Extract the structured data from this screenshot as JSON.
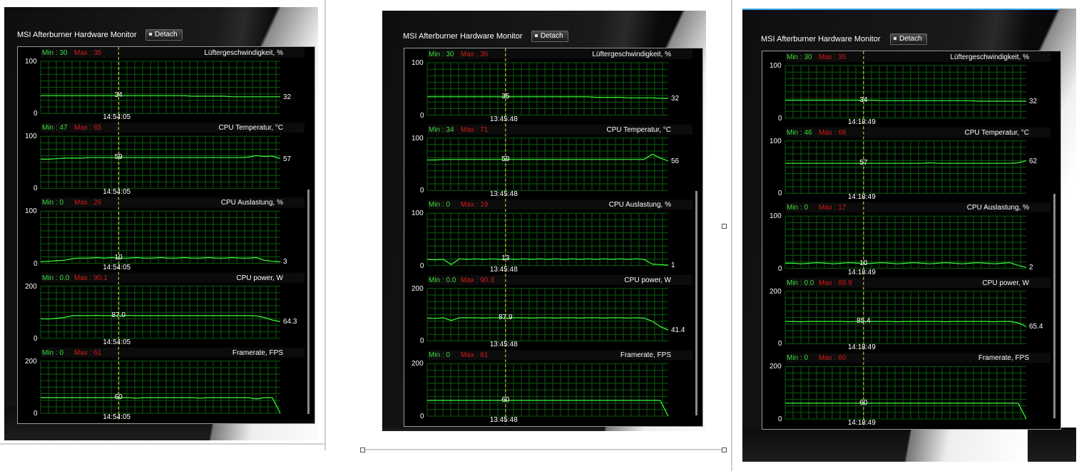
{
  "colors": {
    "grid": "#0b5d0b",
    "line": "#3cff3c",
    "cursor": "#e6e65a",
    "min": "#3cdd3c",
    "max": "#d41a1a"
  },
  "panels": [
    {
      "title": "MSI Afterburner Hardware Monitor",
      "detach": "Detach",
      "graphs": [
        {
          "name": "Lüftergeschwindigkeit, %",
          "min": "Min : 30",
          "max": "Max : 35",
          "ymax": "100",
          "ymin": "0",
          "cursor": "34",
          "current": "32",
          "time": "14:54:05",
          "series": [
            34,
            34,
            34,
            34,
            34,
            34,
            34,
            34,
            34,
            34,
            34,
            34,
            34,
            34,
            34,
            34,
            34,
            34,
            34,
            33,
            33,
            33,
            33,
            33,
            32,
            32,
            32,
            32,
            32,
            32,
            32
          ]
        },
        {
          "name": "CPU Temperatur, °C",
          "min": "Min : 47",
          "max": "Max : 65",
          "ymax": "100",
          "ymin": "0",
          "cursor": "59",
          "current": "57",
          "time": "14:54:05",
          "series": [
            56,
            56,
            57,
            58,
            58,
            58,
            59,
            59,
            59,
            59,
            59,
            59,
            59,
            59,
            59,
            59,
            59,
            59,
            59,
            59,
            59,
            59,
            59,
            59,
            59,
            59,
            60,
            63,
            61,
            62,
            57
          ]
        },
        {
          "name": "CPU Auslastung, %",
          "min": "Min : 0",
          "max": "Max : 26",
          "ymax": "100",
          "ymin": "0",
          "cursor": "10",
          "current": "3",
          "time": "14:54:05",
          "series": [
            3,
            4,
            5,
            6,
            9,
            10,
            10,
            11,
            10,
            11,
            10,
            10,
            11,
            10,
            10,
            11,
            10,
            10,
            11,
            10,
            10,
            11,
            10,
            10,
            11,
            10,
            10,
            11,
            6,
            4,
            3
          ]
        },
        {
          "name": "CPU power, W",
          "min": "Min : 0.0",
          "max": "Max : 90.1",
          "ymax": "200",
          "ymin": "0",
          "cursor": "87.0",
          "current": "64.3",
          "time": "14:54:05",
          "series": [
            75,
            74,
            77,
            80,
            87,
            87,
            87,
            88,
            87,
            87,
            87,
            88,
            87,
            87,
            87,
            87,
            87,
            87,
            87,
            87,
            87,
            87,
            87,
            87,
            87,
            87,
            87,
            86,
            80,
            70,
            64
          ]
        },
        {
          "name": "Framerate, FPS",
          "min": "Min : 0",
          "max": "Max : 61",
          "ymax": "200",
          "ymin": "0",
          "cursor": "60",
          "current": "",
          "time": "14:54:05",
          "series": [
            60,
            60,
            60,
            60,
            60,
            60,
            60,
            60,
            60,
            60,
            60,
            60,
            58,
            60,
            60,
            60,
            60,
            60,
            60,
            60,
            58,
            60,
            60,
            60,
            60,
            60,
            60,
            55,
            60,
            60,
            0
          ]
        }
      ]
    },
    {
      "title": "MSI Afterburner Hardware Monitor",
      "detach": "Detach",
      "graphs": [
        {
          "name": "Lüftergeschwindigkeit, %",
          "min": "Min : 30",
          "max": "Max : 36",
          "ymax": "100",
          "ymin": "0",
          "cursor": "35",
          "current": "32",
          "time": "13:45:48",
          "series": [
            35,
            35,
            35,
            35,
            35,
            35,
            35,
            35,
            35,
            35,
            35,
            35,
            35,
            35,
            35,
            35,
            35,
            35,
            35,
            35,
            35,
            34,
            34,
            34,
            34,
            33,
            33,
            33,
            33,
            32,
            32
          ]
        },
        {
          "name": "CPU Temperatur, °C",
          "min": "Min : 34",
          "max": "Max : 71",
          "ymax": "100",
          "ymin": "0",
          "cursor": "59",
          "current": "56",
          "time": "13:45:48",
          "series": [
            58,
            58,
            59,
            59,
            59,
            59,
            59,
            59,
            59,
            59,
            59,
            59,
            59,
            59,
            59,
            59,
            59,
            59,
            59,
            59,
            59,
            59,
            59,
            59,
            59,
            59,
            59,
            59,
            69,
            62,
            56
          ]
        },
        {
          "name": "CPU Auslastung, %",
          "min": "Min : 0",
          "max": "Max : 19",
          "ymax": "100",
          "ymin": "0",
          "cursor": "13",
          "current": "1",
          "time": "13:45:48",
          "series": [
            12,
            11,
            12,
            2,
            13,
            12,
            13,
            12,
            13,
            12,
            13,
            12,
            13,
            12,
            13,
            12,
            13,
            12,
            13,
            12,
            13,
            12,
            13,
            12,
            13,
            12,
            13,
            12,
            3,
            2,
            1
          ]
        },
        {
          "name": "CPU power, W",
          "min": "Min : 0.0",
          "max": "Max : 90.3",
          "ymax": "200",
          "ymin": "0",
          "cursor": "87.9",
          "current": "41.4",
          "time": "13:45:48",
          "series": [
            87,
            86,
            88,
            78,
            88,
            88,
            88,
            87,
            88,
            88,
            87,
            88,
            88,
            87,
            88,
            88,
            87,
            88,
            88,
            87,
            88,
            88,
            87,
            88,
            88,
            87,
            88,
            87,
            75,
            55,
            41
          ]
        },
        {
          "name": "Framerate, FPS",
          "min": "Min : 0",
          "max": "Max : 61",
          "ymax": "200",
          "ymin": "0",
          "cursor": "60",
          "current": "",
          "time": "13:45:48",
          "series": [
            60,
            60,
            60,
            60,
            60,
            60,
            60,
            60,
            60,
            60,
            60,
            60,
            60,
            60,
            60,
            60,
            60,
            60,
            60,
            60,
            60,
            60,
            60,
            60,
            60,
            60,
            60,
            60,
            60,
            60,
            0
          ]
        }
      ]
    },
    {
      "title": "MSI Afterburner Hardware Monitor",
      "detach": "Detach",
      "graphs": [
        {
          "name": "Lüftergeschwindigkeit, %",
          "min": "Min : 30",
          "max": "Max : 35",
          "ymax": "100",
          "ymin": "0",
          "cursor": "34",
          "current": "32",
          "time": "14:18:49",
          "series": [
            34,
            34,
            34,
            34,
            34,
            34,
            34,
            34,
            34,
            34,
            34,
            34,
            33,
            33,
            33,
            33,
            33,
            33,
            33,
            33,
            33,
            33,
            33,
            33,
            32,
            32,
            32,
            32,
            32,
            32,
            32
          ]
        },
        {
          "name": "CPU Temperatur, °C",
          "min": "Min : 46",
          "max": "Max : 68",
          "ymax": "100",
          "ymin": "0",
          "cursor": "57",
          "current": "62",
          "time": "14:18:49",
          "series": [
            57,
            57,
            57,
            57,
            57,
            57,
            57,
            57,
            57,
            57,
            57,
            57,
            57,
            57,
            57,
            57,
            57,
            57,
            58,
            57,
            57,
            57,
            57,
            57,
            57,
            57,
            57,
            57,
            57,
            58,
            62
          ]
        },
        {
          "name": "CPU Auslastung, %",
          "min": "Min : 0",
          "max": "Max : 17",
          "ymax": "100",
          "ymin": "0",
          "cursor": "10",
          "current": "2",
          "time": "14:18:49",
          "series": [
            10,
            10,
            9,
            10,
            11,
            10,
            9,
            10,
            11,
            10,
            9,
            10,
            11,
            10,
            9,
            10,
            11,
            10,
            9,
            10,
            11,
            10,
            9,
            10,
            11,
            10,
            9,
            10,
            11,
            6,
            2
          ]
        },
        {
          "name": "CPU power, W",
          "min": "Min : 0.0",
          "max": "Max : 89.9",
          "ymax": "200",
          "ymin": "0",
          "cursor": "85.4",
          "current": "65.4",
          "time": "14:18:49",
          "series": [
            85,
            85,
            84,
            85,
            85,
            85,
            85,
            85,
            84,
            85,
            85,
            85,
            85,
            85,
            84,
            85,
            85,
            85,
            85,
            85,
            84,
            85,
            85,
            85,
            85,
            85,
            84,
            85,
            85,
            80,
            65
          ]
        },
        {
          "name": "Framerate, FPS",
          "min": "Min : 0",
          "max": "Max : 60",
          "ymax": "200",
          "ymin": "0",
          "cursor": "60",
          "current": "",
          "time": "14:18:49",
          "series": [
            60,
            60,
            60,
            60,
            60,
            60,
            60,
            60,
            60,
            60,
            60,
            60,
            60,
            60,
            60,
            60,
            60,
            60,
            60,
            60,
            60,
            60,
            60,
            60,
            60,
            60,
            60,
            60,
            60,
            60,
            0
          ]
        }
      ]
    }
  ]
}
